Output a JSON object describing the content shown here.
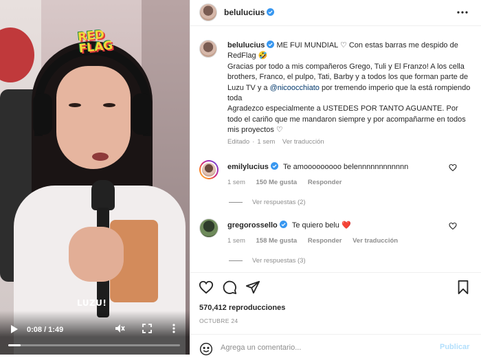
{
  "video": {
    "time": "0:08 / 1:49",
    "progress": 0.07,
    "overlay_logo_lines": [
      "RED",
      "FLAG"
    ],
    "watermark": "LUZU!",
    "icons": [
      "play-icon",
      "volume-muted-icon",
      "fullscreen-icon",
      "more-vertical-icon"
    ]
  },
  "header": {
    "username": "belulucius",
    "more_icon": "more-horizontal-icon"
  },
  "caption": {
    "username": "belulucius",
    "line1": " ME FUI MUNDIAL ♡ Con estas barras me despido de RedFlag 🤣",
    "line2_pre": "Gracias por todo a mis compañeros Grego, Tuli y El Franzo! A los cella brothers, Franco, el pulpo, Tati, Barby y a todos los que forman parte de Luzu TV y a ",
    "mention": "@nicoocchiato",
    "line2_post": " por tremendo imperio que la está rompiendo toda",
    "line3": "Agradezco especialmente a USTEDES POR TANTO AGUANTE. Por todo el cariño que me mandaron siempre y por acompañarme en todos mis proyectos ♡",
    "edited": "Editado",
    "age": "1 sem",
    "translate": "Ver traducción"
  },
  "comments": [
    {
      "username": "emilylucius",
      "text": "Te amooooooooo belennnnnnnnnnnn",
      "age": "1 sem",
      "likes": "150 Me gusta",
      "reply": "Responder",
      "translate": "",
      "replies": "Ver respuestas (2)"
    },
    {
      "username": "gregorossello",
      "text": "Te quiero belu ❤️",
      "age": "1 sem",
      "likes": "158 Me gusta",
      "reply": "Responder",
      "translate": "Ver traducción",
      "replies": "Ver respuestas (3)"
    }
  ],
  "actions": {
    "icons": [
      "heart-icon",
      "comment-icon",
      "share-icon",
      "bookmark-icon"
    ],
    "views": "570,412 reproducciones",
    "date": "OCTUBRE 24"
  },
  "composer": {
    "placeholder": "Agrega un comentario...",
    "post_label": "Publicar"
  },
  "colors": {
    "verified": "#3897f0",
    "link": "#00376b",
    "muted": "#8e8e8e",
    "post_disabled": "#b2dffc",
    "heart_red": "#ed4956"
  }
}
